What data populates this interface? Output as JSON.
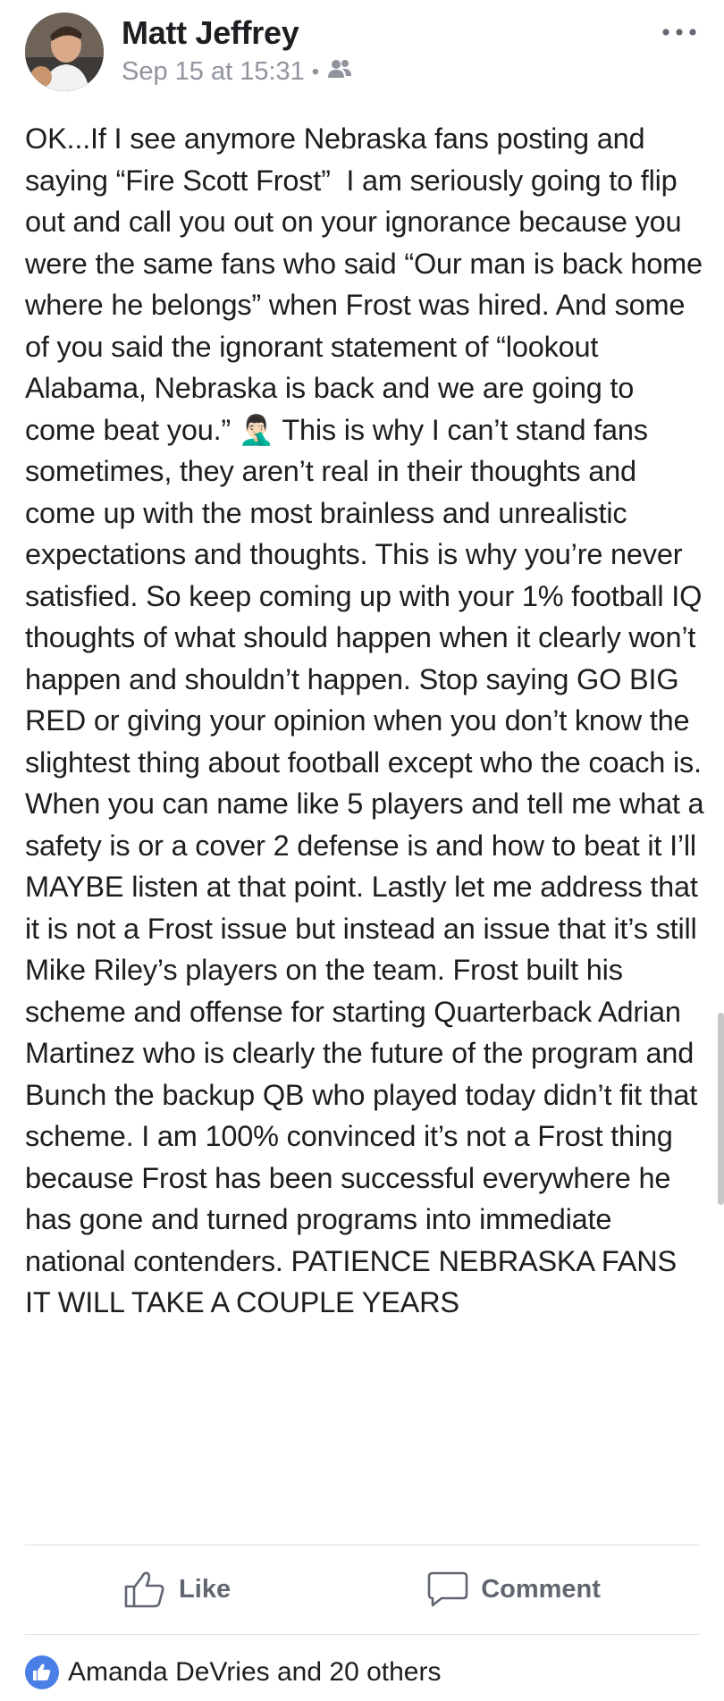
{
  "post": {
    "author": "Matt Jeffrey",
    "timestamp": "Sep 15 at 15:31",
    "separator": "•",
    "audience_icon": "friends-icon",
    "more_icon": "more-options-icon",
    "body": "OK...If I see anymore Nebraska fans posting and saying “Fire Scott Frost”  I am seriously going to flip out and call you out on your ignorance because you were the same fans who said “Our man is back home where he belongs” when Frost was hired. And some of you said the ignorant statement of “lookout Alabama, Nebraska is back and we are going to come beat you.” 🤦🏻‍♂️ This is why I can’t stand fans sometimes, they aren’t real in their thoughts and come up with the most brainless and unrealistic expectations and thoughts. This is why you’re never satisfied. So keep coming up with your 1% football IQ thoughts of what should happen when it clearly won’t happen and shouldn’t happen. Stop saying GO BIG RED or giving your opinion when you don’t know the slightest thing about football except who the coach is. When you can name like 5 players and tell me what a safety is or a cover 2 defense is and how to beat it I’ll MAYBE listen at that point. Lastly let me address that it is not a Frost issue but instead an issue that it’s still Mike Riley’s players on the team. Frost built his scheme and offense for starting Quarterback Adrian Martinez who is clearly the future of the program and Bunch the backup QB who played today didn’t fit that scheme. I am 100% convinced it’s not a Frost thing because Frost has been successful everywhere he has gone and turned programs into immediate national contenders. PATIENCE NEBRASKA FANS IT WILL TAKE A COUPLE YEARS"
  },
  "actions": {
    "like_label": "Like",
    "comment_label": "Comment"
  },
  "reactions": {
    "summary": "Amanda DeVries and 20 others"
  },
  "colors": {
    "secondary_text": "#90949c",
    "action_text": "#606770",
    "like_blue": "#4b7fe8",
    "divider": "#dddfe2"
  }
}
